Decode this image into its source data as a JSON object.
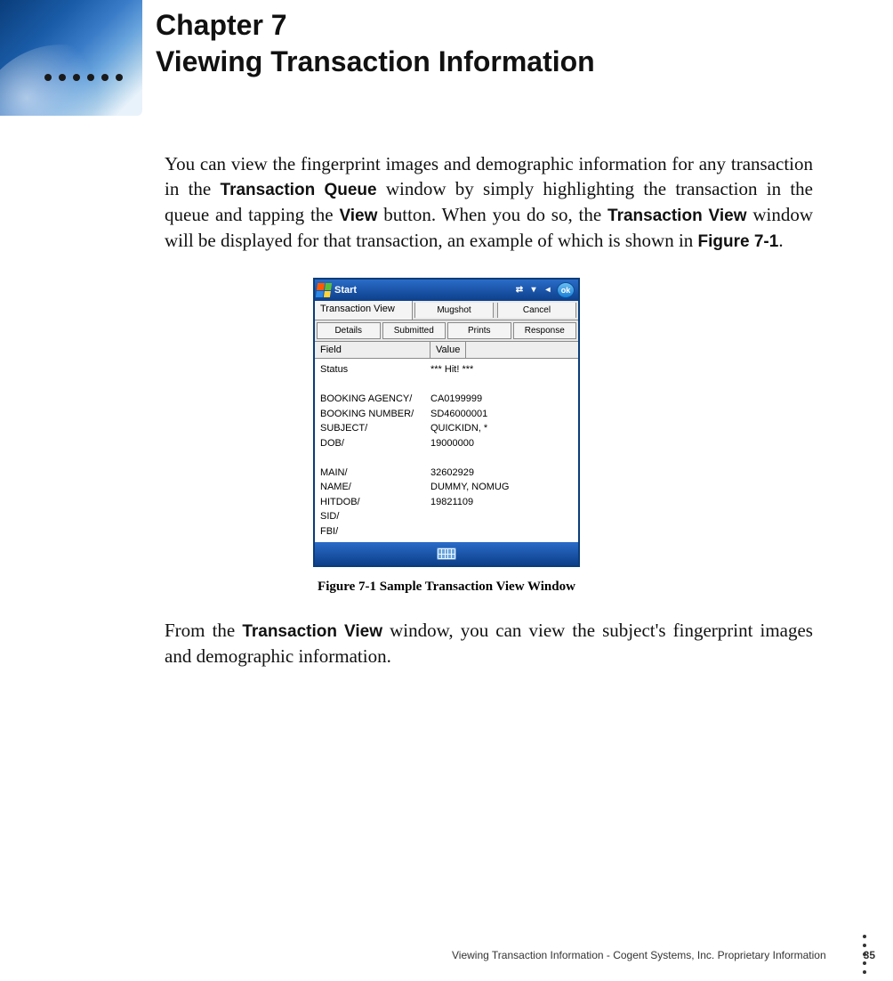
{
  "chapter": {
    "number": "Chapter 7",
    "title": "Viewing Transaction Information"
  },
  "para1": {
    "t1": "You can view the fingerprint images and demographic information for any transaction in the ",
    "b1": "Transaction Queue",
    "t2": " window by simply highlighting the transaction in the queue and tapping the ",
    "b2": "View",
    "t3": " button. When you do so, the ",
    "b3": "Transaction View",
    "t4": " window will be displayed for that transaction, an example of which is shown in ",
    "b4": "Figure 7-1",
    "t5": "."
  },
  "device": {
    "start": "Start",
    "ok": "ok",
    "row1_label": "Transaction View",
    "row1_btn1": "Mugshot",
    "row1_btn2": "Cancel",
    "tabs": {
      "t1": "Details",
      "t2": "Submitted",
      "t3": "Prints",
      "t4": "Response"
    },
    "col_field": "Field",
    "col_value": "Value",
    "fields": [
      {
        "k": "Status",
        "v": "*** Hit! ***"
      },
      {
        "k": "",
        "v": ""
      },
      {
        "k": "BOOKING AGENCY/",
        "v": "CA0199999"
      },
      {
        "k": "BOOKING NUMBER/",
        "v": "SD46000001"
      },
      {
        "k": "SUBJECT/",
        "v": "QUICKIDN, *"
      },
      {
        "k": "DOB/",
        "v": "19000000"
      },
      {
        "k": "",
        "v": ""
      },
      {
        "k": "MAIN/",
        "v": "32602929"
      },
      {
        "k": "NAME/",
        "v": "DUMMY, NOMUG"
      },
      {
        "k": "HITDOB/",
        "v": "19821109"
      },
      {
        "k": "SID/",
        "v": ""
      },
      {
        "k": "FBI/",
        "v": ""
      }
    ]
  },
  "figcaption": "Figure 7-1 Sample Transaction View Window",
  "para2": {
    "t1": "From the ",
    "b1": "Transaction View",
    "t2": " window, you can view the subject's fingerprint images and demographic information."
  },
  "footer": {
    "text": "Viewing Transaction Information  - Cogent Systems, Inc. Proprietary Information",
    "page": "35"
  }
}
